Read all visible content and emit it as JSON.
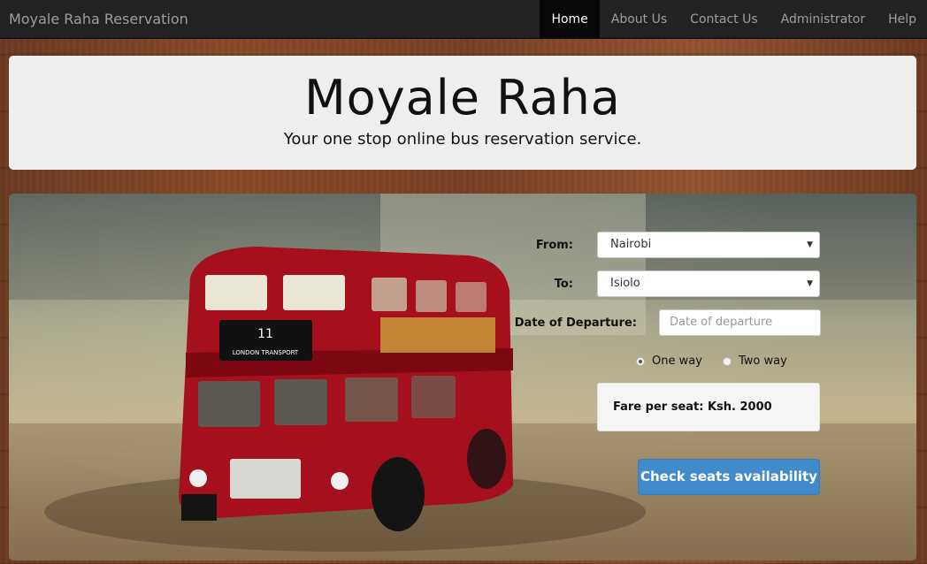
{
  "navbar": {
    "brand": "Moyale Raha Reservation",
    "items": [
      {
        "label": "Home",
        "active": true
      },
      {
        "label": "About Us"
      },
      {
        "label": "Contact Us"
      },
      {
        "label": "Administrator"
      },
      {
        "label": "Help"
      }
    ]
  },
  "hero": {
    "title": "Moyale Raha",
    "subtitle": "Your one stop online bus reservation service."
  },
  "bus_image": {
    "destination_number": "11",
    "destination_text": "LONDON TRANSPORT"
  },
  "form": {
    "from_label": "From:",
    "from_value": "Nairobi",
    "to_label": "To:",
    "to_value": "Isiolo",
    "date_label": "Date of Departure:",
    "date_placeholder": "Date of departure",
    "trip_options": [
      {
        "label": "One way",
        "checked": true
      },
      {
        "label": "Two way",
        "checked": false
      }
    ],
    "fare_text": "Fare per seat: Ksh. 2000",
    "submit_label": "Check seats availability"
  },
  "colors": {
    "navbar_bg": "#222222",
    "primary_button": "#428bca",
    "jumbotron_bg": "#eeeeee"
  }
}
